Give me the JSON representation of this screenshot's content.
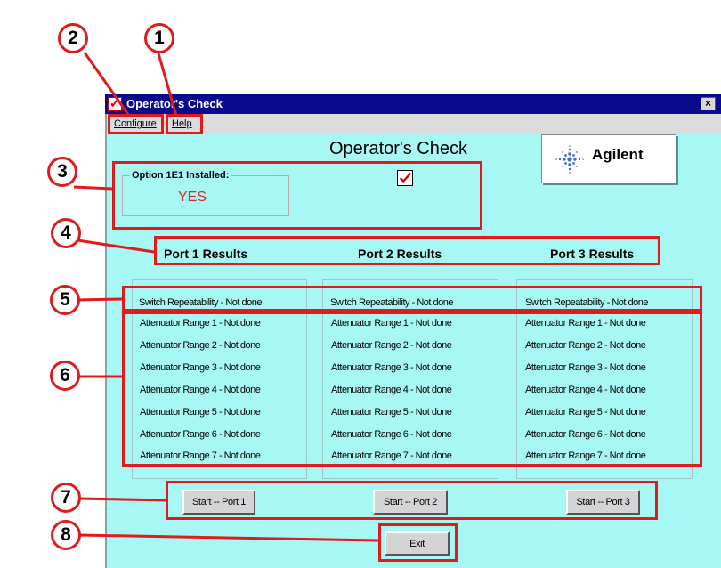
{
  "window": {
    "title": "Operator's Check",
    "close_glyph": "×",
    "icon": "check-app-icon"
  },
  "menu": {
    "configure": "Configure",
    "help": "Help"
  },
  "main_title": "Operator's Check",
  "logo": {
    "text": "Agilent",
    "icon": "agilent-spark-icon"
  },
  "option": {
    "label": "Option 1E1 Installed:",
    "value": "YES",
    "checked": true
  },
  "ports": [
    {
      "header": "Port 1 Results",
      "switch": "Switch Repeatability - Not done",
      "attenuators": [
        "Attenuator Range 1 - Not done",
        "Attenuator Range 2 - Not done",
        "Attenuator Range 3 - Not done",
        "Attenuator Range 4 - Not done",
        "Attenuator Range 5 - Not done",
        "Attenuator Range 6 - Not done",
        "Attenuator Range 7 - Not done"
      ],
      "button": "Start -- Port 1"
    },
    {
      "header": "Port 2 Results",
      "switch": "Switch Repeatability - Not done",
      "attenuators": [
        "Attenuator Range 1 - Not done",
        "Attenuator Range 2 - Not done",
        "Attenuator Range 3 - Not done",
        "Attenuator Range 4 - Not done",
        "Attenuator Range 5 - Not done",
        "Attenuator Range 6 - Not done",
        "Attenuator Range 7 - Not done"
      ],
      "button": "Start -- Port 2"
    },
    {
      "header": "Port 3 Results",
      "switch": "Switch Repeatability - Not done",
      "attenuators": [
        "Attenuator Range 1 - Not done",
        "Attenuator Range 2 - Not done",
        "Attenuator Range 3 - Not done",
        "Attenuator Range 4 - Not done",
        "Attenuator Range 5 - Not done",
        "Attenuator Range 6 - Not done",
        "Attenuator Range 7 - Not done"
      ],
      "button": "Start -- Port 3"
    }
  ],
  "exit_button": "Exit",
  "callouts": [
    "1",
    "2",
    "3",
    "4",
    "5",
    "6",
    "7",
    "8"
  ],
  "colors": {
    "window_bg": "#a7f7f5",
    "titlebar": "#0a0a8c",
    "annotation_red": "#e01b1b",
    "yes_red": "#d62b2b"
  }
}
